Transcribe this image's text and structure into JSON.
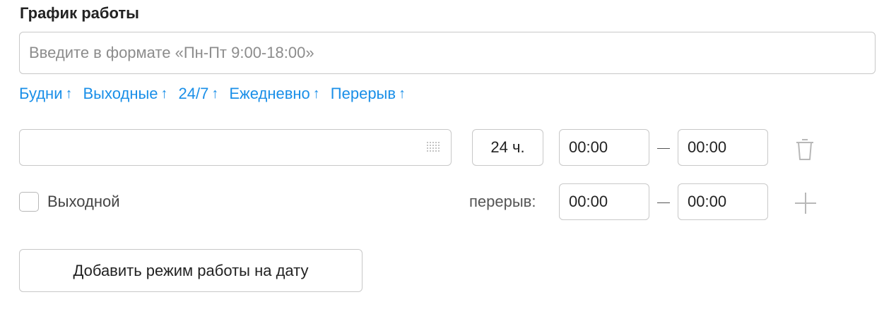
{
  "section": {
    "title": "График работы",
    "input_placeholder": "Введите в формате «Пн-Пт 9:00-18:00»",
    "input_value": ""
  },
  "presets": [
    {
      "label": "Будни",
      "arrow": "↑"
    },
    {
      "label": "Выходные",
      "arrow": "↑"
    },
    {
      "label": "24/7",
      "arrow": "↑"
    },
    {
      "label": "Ежедневно",
      "arrow": "↑"
    },
    {
      "label": "Перерыв",
      "arrow": "↑"
    }
  ],
  "schedule_row": {
    "days_value": "",
    "all_day_label": "24 ч.",
    "from_time": "00:00",
    "to_time": "00:00",
    "day_off_label": "Выходной",
    "day_off_checked": false,
    "break_label": "перерыв:",
    "break_from": "00:00",
    "break_to": "00:00"
  },
  "add_date_button": "Добавить режим работы на дату",
  "colors": {
    "link": "#1a8fe8",
    "border": "#c8c8c8",
    "icon": "#b8b8b8"
  }
}
